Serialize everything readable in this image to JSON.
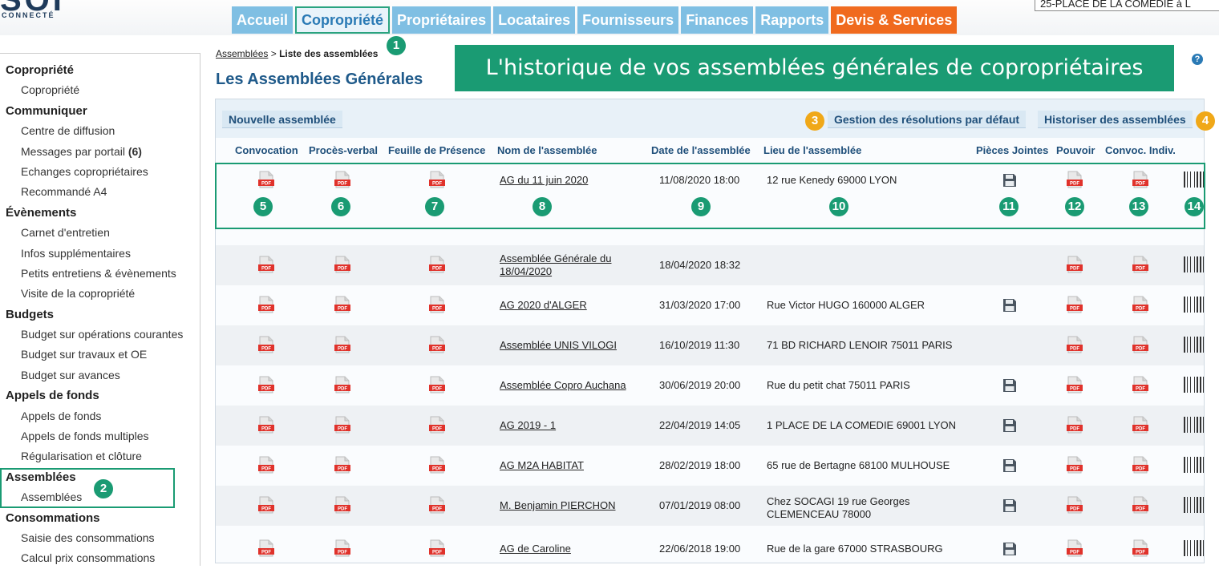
{
  "header": {
    "logo_big": "SOI",
    "logo_small": "CONNECTÉ",
    "address": "25-PLACE DE LA COMEDIE à L"
  },
  "tabs": [
    {
      "label": "Accueil"
    },
    {
      "label": "Copropriété"
    },
    {
      "label": "Propriétaires"
    },
    {
      "label": "Locataires"
    },
    {
      "label": "Fournisseurs"
    },
    {
      "label": "Finances"
    },
    {
      "label": "Rapports"
    },
    {
      "label": "Devis & Services"
    }
  ],
  "colors": {
    "accent_green": "#1a9b73",
    "tab_blue": "#7fbfe3",
    "tab_orange": "#f06a1e",
    "marker_orange": "#f0a818"
  },
  "markers": [
    "1",
    "2",
    "3",
    "4",
    "5",
    "6",
    "7",
    "8",
    "9",
    "10",
    "11",
    "12",
    "13",
    "14"
  ],
  "sidebar": {
    "sections": [
      {
        "title": "Copropriété",
        "items": [
          "Copropriété"
        ]
      },
      {
        "title": "Communiquer",
        "items": [
          "Centre de diffusion",
          "Messages par portail",
          "Echanges copropriétaires",
          "Recommandé A4"
        ]
      },
      {
        "title": "Évènements",
        "items": [
          "Carnet d'entretien",
          "Infos supplémentaires",
          "Petits entretiens & évènements",
          "Visite de la copropriété"
        ]
      },
      {
        "title": "Budgets",
        "items": [
          "Budget sur opérations courantes",
          "Budget sur travaux et OE",
          "Budget sur avances"
        ]
      },
      {
        "title": "Appels de fonds",
        "items": [
          "Appels de fonds",
          "Appels de fonds multiples",
          "Régularisation et clôture"
        ]
      },
      {
        "title": "Assemblées",
        "items": [
          "Assemblées"
        ]
      },
      {
        "title": "Consommations",
        "items": [
          "Saisie des consommations",
          "Calcul prix consommations"
        ]
      }
    ],
    "messages_count": "(6)"
  },
  "breadcrumb": {
    "link": "Assemblées",
    "separator": " > ",
    "current": "Liste des assemblées"
  },
  "page_title": "Les Assemblées Générales",
  "banner": "L'historique de vos assemblées générales de copropriétaires",
  "help_icon": "?",
  "toolbar": {
    "new_label": "Nouvelle assemblée",
    "resolutions_label": "Gestion des résolutions par défaut",
    "archive_label": "Historiser des assemblées"
  },
  "columns": [
    "Convocation",
    "Procès-verbal",
    "Feuille de Présence",
    "Nom de l'assemblée",
    "Date de l'assemblée",
    "Lieu de l'assemblée",
    "Pièces Jointes",
    "Pouvoir",
    "Convoc. Indiv."
  ],
  "rows": [
    {
      "name": "AG du 11 juin 2020",
      "name2": "",
      "date": "11/08/2020 18:00",
      "place": "12 rue Kenedy 69000 LYON",
      "place2": "",
      "attach": true
    },
    {
      "name": "Assemblée Générale du",
      "name2": "18/04/2020",
      "date": "18/04/2020 18:32",
      "place": "",
      "place2": "",
      "attach": false
    },
    {
      "name": "AG 2020 d'ALGER",
      "name2": "",
      "date": "31/03/2020 17:00",
      "place": "Rue Victor HUGO 160000 ALGER",
      "place2": "",
      "attach": true
    },
    {
      "name": "Assemblée UNIS VILOGI",
      "name2": "",
      "date": "16/10/2019 11:30",
      "place": "71 BD RICHARD LENOIR 75011 PARIS",
      "place2": "",
      "attach": false
    },
    {
      "name": "Assemblée Copro Auchana",
      "name2": "",
      "date": "30/06/2019 20:00",
      "place": "Rue du petit chat 75011 PARIS",
      "place2": "",
      "attach": true
    },
    {
      "name": "AG 2019 - 1",
      "name2": "",
      "date": "22/04/2019 14:05",
      "place": "1 PLACE DE LA COMEDIE 69001 LYON",
      "place2": "",
      "attach": true
    },
    {
      "name": "AG M2A HABITAT",
      "name2": "",
      "date": "28/02/2019 18:00",
      "place": "65 rue de Bertagne 68100 MULHOUSE",
      "place2": "",
      "attach": true
    },
    {
      "name": "M. Benjamin PIERCHON",
      "name2": "",
      "date": "07/01/2019 08:00",
      "place": "Chez SOCAGI 19 rue Georges",
      "place2": "CLEMENCEAU 78000",
      "attach": true
    },
    {
      "name": "AG de Caroline",
      "name2": "",
      "date": "22/06/2018 19:00",
      "place": "Rue de la gare 67000 STRASBOURG",
      "place2": "",
      "attach": true
    }
  ],
  "pdf_label": "PDF",
  "icons": {
    "pdf": "pdf-file-icon",
    "save": "floppy-disk-icon",
    "barcode": "barcode-icon",
    "help": "help-icon"
  }
}
